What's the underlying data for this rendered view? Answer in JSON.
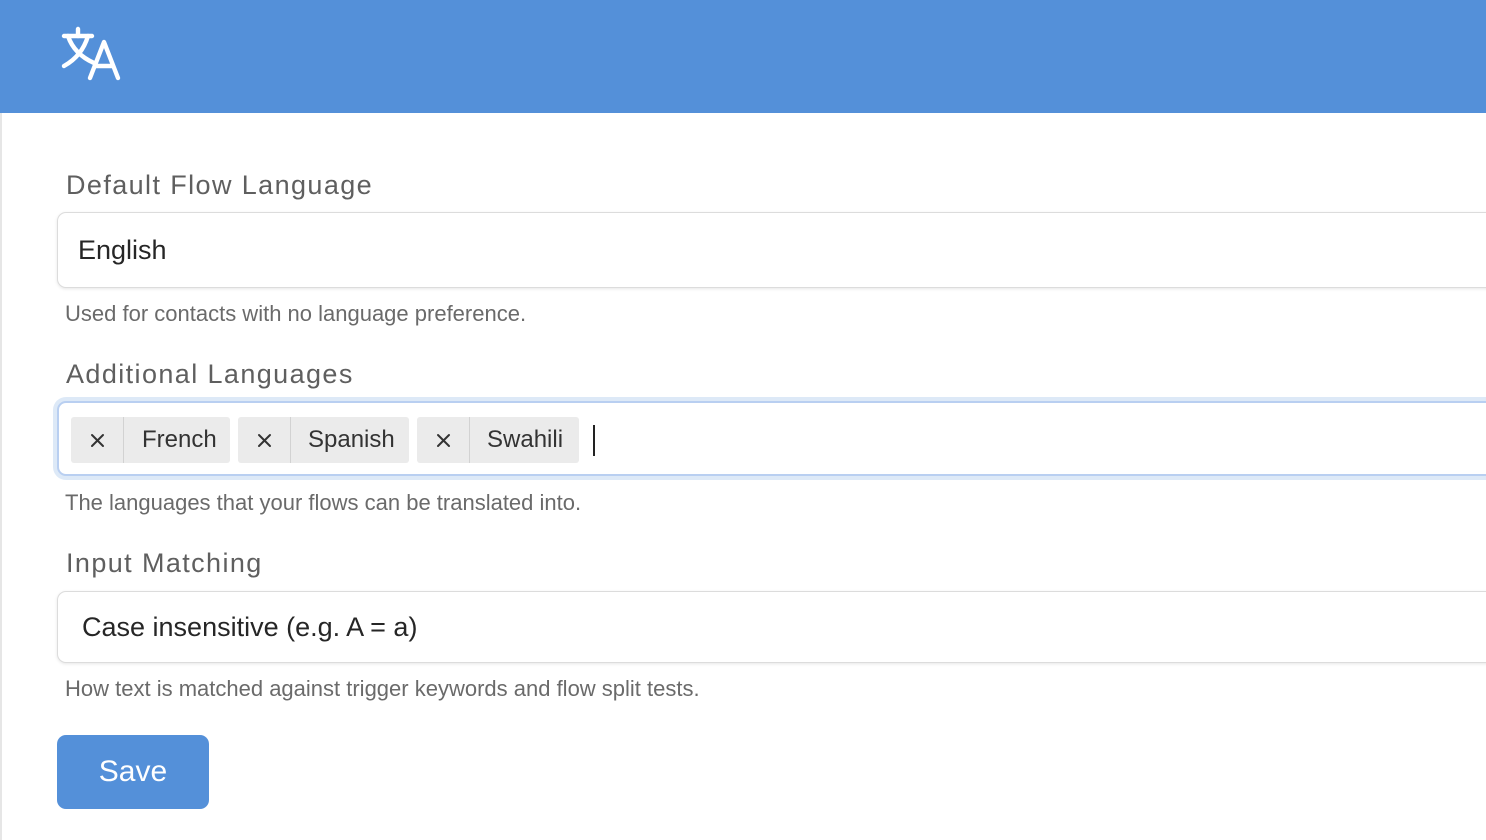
{
  "header": {
    "icon": "translate-icon",
    "color": "#5490d9"
  },
  "default_language": {
    "label": "Default Flow Language",
    "value": "English",
    "help": "Used for contacts with no language preference."
  },
  "additional_languages": {
    "label": "Additional Languages",
    "chips": [
      {
        "label": "French"
      },
      {
        "label": "Spanish"
      },
      {
        "label": "Swahili"
      }
    ],
    "help": "The languages that your flows can be translated into."
  },
  "input_matching": {
    "label": "Input Matching",
    "value": "Case insensitive (e.g. A = a)",
    "help": "How text is matched against trigger keywords and flow split tests."
  },
  "save_label": "Save"
}
